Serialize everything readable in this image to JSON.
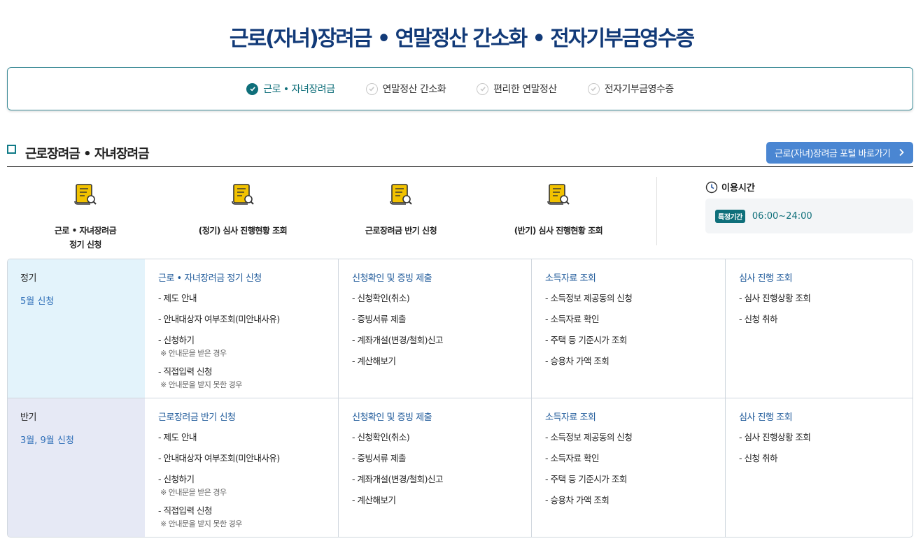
{
  "page": {
    "title": "근로(자녀)장려금 • 연말정산 간소화 • 전자기부금영수증"
  },
  "tabs": [
    {
      "label": "근로 • 자녀장려금",
      "active": true
    },
    {
      "label": "연말정산 간소화",
      "active": false
    },
    {
      "label": "편리한 연말정산",
      "active": false
    },
    {
      "label": "전자기부금영수증",
      "active": false
    }
  ],
  "section": {
    "title": "근로장려금 • 자녀장려금",
    "portal_button": "근로(자녀)장려금 포털 바로가기"
  },
  "quick_links": [
    {
      "label": "근로 • 자녀장려금",
      "label2": "정기 신청",
      "icon": "document-search-icon"
    },
    {
      "label": "(정기) 심사 진행현황 조회",
      "label2": "",
      "icon": "document-search-icon"
    },
    {
      "label": "근로장려금 반기 신청",
      "label2": "",
      "icon": "document-search-icon"
    },
    {
      "label": "(반기) 심사 진행현황 조회",
      "label2": "",
      "icon": "document-search-icon"
    }
  ],
  "hours": {
    "title": "이용시간",
    "badge": "특정기간",
    "time": "06:00~24:00"
  },
  "rows": [
    {
      "title": "정기",
      "subtitle": "5월 신청",
      "columns": [
        {
          "title": "근로 • 자녀장려금 정기 신청",
          "items": [
            "- 제도 안내",
            "- 안내대상자 여부조회(미안내사유)",
            "- 신청하기",
            "- 직접입력 신청"
          ],
          "notes": [
            "※ 안내문을 받은 경우",
            "※ 안내문을 받지 못한 경우"
          ]
        },
        {
          "title": "신청확인 및 증빙 제출",
          "items": [
            "- 신청확인(취소)",
            "- 증빙서류 제출",
            "- 계좌개설(변경/철회)신고",
            "- 계산해보기"
          ]
        },
        {
          "title": "소득자료 조회",
          "items": [
            "- 소득정보 제공동의 신청",
            "- 소득자료 확인",
            "- 주택 등 기준시가 조회",
            "- 승용차 가액 조회"
          ]
        },
        {
          "title": "심사 진행 조회",
          "items": [
            "- 심사 진행상황 조회",
            "- 신청 취하"
          ]
        }
      ]
    },
    {
      "title": "반기",
      "subtitle": "3월, 9월 신청",
      "columns": [
        {
          "title": "근로장려금 반기 신청",
          "items": [
            "- 제도 안내",
            "- 안내대상자 여부조회(미안내사유)",
            "- 신청하기",
            "- 직접입력 신청"
          ],
          "notes": [
            "※ 안내문을 받은 경우",
            "※ 안내문을 받지 못한 경우"
          ]
        },
        {
          "title": "신청확인 및 증빙 제출",
          "items": [
            "- 신청확인(취소)",
            "- 증빙서류 제출",
            "- 계좌개설(변경/철회)신고",
            "- 계산해보기"
          ]
        },
        {
          "title": "소득자료 조회",
          "items": [
            "- 소득정보 제공동의 신청",
            "- 소득자료 확인",
            "- 주택 등 기준시가 조회",
            "- 승용차 가액 조회"
          ]
        },
        {
          "title": "심사 진행 조회",
          "items": [
            "- 심사 진행상황 조회",
            "- 신청 취하"
          ]
        }
      ]
    }
  ],
  "colors": {
    "brand_navy": "#123a78",
    "teal": "#0f6f7a",
    "link_blue": "#1f5a9a",
    "button_blue": "#4a86d2",
    "icon_yellow": "#f2c200"
  }
}
